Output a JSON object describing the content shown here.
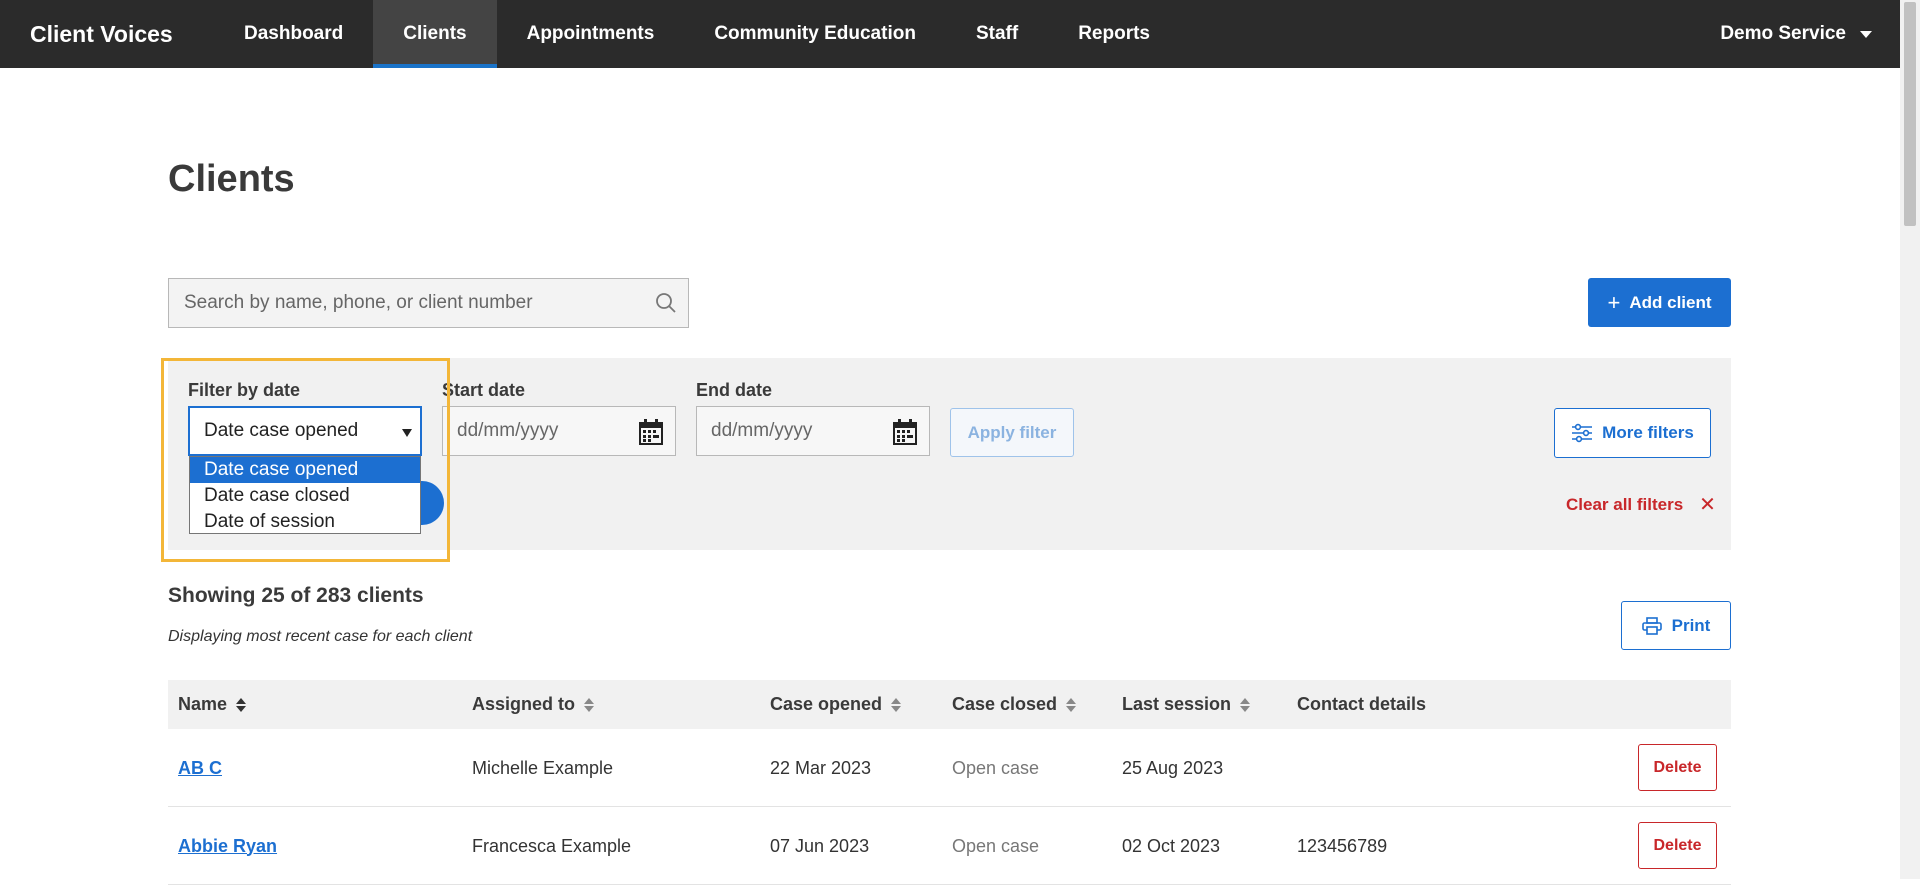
{
  "nav": {
    "brand": "Client Voices",
    "items": [
      {
        "label": "Dashboard"
      },
      {
        "label": "Clients"
      },
      {
        "label": "Appointments"
      },
      {
        "label": "Community Education"
      },
      {
        "label": "Staff"
      },
      {
        "label": "Reports"
      }
    ],
    "active": "Clients",
    "account": "Demo Service"
  },
  "page": {
    "title": "Clients"
  },
  "search": {
    "placeholder": "Search by name, phone, or client number"
  },
  "add_client": {
    "label": "Add client"
  },
  "filters": {
    "filter_by_date_label": "Filter by date",
    "selected_date_field": "Date case opened",
    "options": [
      "Date case opened",
      "Date case closed",
      "Date of session"
    ],
    "start_date_label": "Start date",
    "end_date_label": "End date",
    "date_placeholder": "dd/mm/yyyy",
    "apply_label": "Apply filter",
    "more_filters_label": "More filters",
    "clear_all_label": "Clear all filters"
  },
  "results": {
    "showing": "Showing 25 of 283 clients",
    "note": "Displaying most recent case for each client",
    "print_label": "Print"
  },
  "table": {
    "headers": [
      "Name",
      "Assigned to",
      "Case opened",
      "Case closed",
      "Last session",
      "Contact details"
    ],
    "rows": [
      {
        "name": "AB C",
        "assigned": "Michelle Example",
        "opened": "22 Mar 2023",
        "closed": "Open case",
        "last_session": "25 Aug 2023",
        "contact": "",
        "action": "Delete"
      },
      {
        "name": "Abbie Ryan",
        "assigned": "Francesca Example",
        "opened": "07 Jun 2023",
        "closed": "Open case",
        "last_session": "02 Oct 2023",
        "contact": "123456789",
        "action": "Delete"
      }
    ]
  },
  "colors": {
    "nav_bg": "#2b2b2b",
    "primary": "#1c6fd1",
    "danger": "#c8272a",
    "highlight": "#f3b638"
  }
}
